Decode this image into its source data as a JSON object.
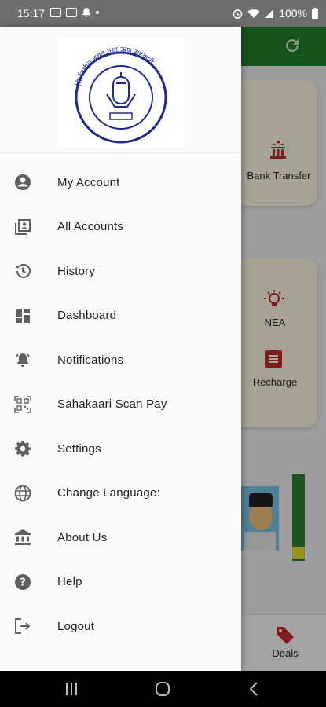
{
  "status": {
    "time": "15:17",
    "battery": "100%"
  },
  "app": {
    "bank_transfer": "Bank Transfer",
    "nea": "NEA",
    "recharge": "Recharge",
    "deals": "Deals"
  },
  "drawer": {
    "logo_text": "सिर्जनशील बचत तथा ऋण सहकारी",
    "items": [
      {
        "label": "My Account",
        "icon": "account-circle-icon"
      },
      {
        "label": "All Accounts",
        "icon": "accounts-icon"
      },
      {
        "label": "History",
        "icon": "history-icon"
      },
      {
        "label": "Dashboard",
        "icon": "dashboard-icon"
      },
      {
        "label": "Notifications",
        "icon": "bell-icon"
      },
      {
        "label": "Sahakaari Scan Pay",
        "icon": "qr-scan-icon"
      },
      {
        "label": "Settings",
        "icon": "gear-icon"
      },
      {
        "label": "Change Language:",
        "icon": "globe-icon"
      },
      {
        "label": "About Us",
        "icon": "bank-icon"
      },
      {
        "label": "Help",
        "icon": "help-icon"
      },
      {
        "label": "Logout",
        "icon": "logout-icon"
      }
    ]
  }
}
